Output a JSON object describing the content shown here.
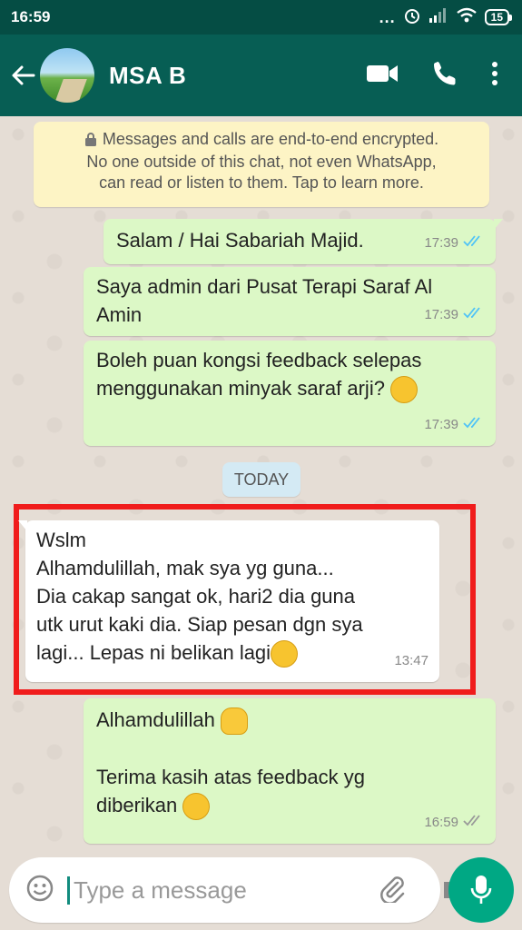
{
  "status_bar": {
    "time": "16:59",
    "dots": "...",
    "battery": "15"
  },
  "header": {
    "contact_name": "MSA B"
  },
  "encryption_notice": {
    "line1": "Messages and calls are end-to-end encrypted.",
    "line2": "No one outside of this chat, not even WhatsApp,",
    "line3": "can read or listen to them. Tap to learn more."
  },
  "messages": [
    {
      "lines": [
        "Salam / Hai Sabariah Majid."
      ],
      "time": "17:39"
    },
    {
      "lines": [
        "Saya admin dari Pusat Terapi Saraf Al",
        "Amin"
      ],
      "time": "17:39"
    },
    {
      "lines": [
        "Boleh puan kongsi feedback selepas",
        "menggunakan minyak saraf arji? "
      ],
      "time": "17:39"
    }
  ],
  "date_chip": "TODAY",
  "incoming": {
    "lines": [
      "Wslm",
      "Alhamdulillah, mak sya yg guna...",
      "Dia cakap sangat ok, hari2 dia guna",
      "utk urut kaki dia. Siap pesan dgn sya",
      "lagi... Lepas ni belikan lagi"
    ],
    "time": "13:47"
  },
  "reply": {
    "line1": "Alhamdulillah ",
    "line2": "Terima kasih atas feedback yg",
    "line3": "diberikan ",
    "time": "16:59"
  },
  "input": {
    "placeholder": "Type a message"
  },
  "colors": {
    "header": "#075e54",
    "status_bar": "#054d44",
    "outgoing_bubble": "#dcf8c6",
    "incoming_bubble": "#ffffff",
    "read_ticks": "#4fc3f7",
    "highlight_border": "#f01c1c",
    "mic_button": "#00a884"
  }
}
